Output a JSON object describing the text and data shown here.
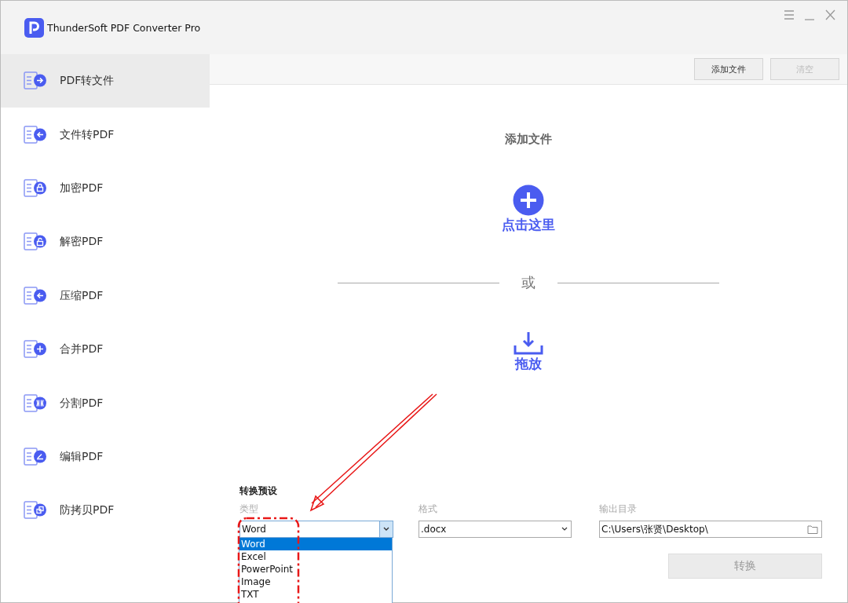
{
  "window": {
    "title": "ThunderSoft PDF Converter Pro"
  },
  "sidebar": {
    "items": [
      {
        "label": "PDF转文件",
        "kind": "export",
        "selected": true
      },
      {
        "label": "文件转PDF",
        "kind": "import",
        "selected": false
      },
      {
        "label": "加密PDF",
        "kind": "lock",
        "selected": false
      },
      {
        "label": "解密PDF",
        "kind": "unlock",
        "selected": false
      },
      {
        "label": "压缩PDF",
        "kind": "import",
        "selected": false
      },
      {
        "label": "合并PDF",
        "kind": "plus",
        "selected": false
      },
      {
        "label": "分割PDF",
        "kind": "split",
        "selected": false
      },
      {
        "label": "编辑PDF",
        "kind": "edit",
        "selected": false
      },
      {
        "label": "防拷贝PDF",
        "kind": "copy",
        "selected": false
      }
    ]
  },
  "toolbar": {
    "buttons": [
      {
        "label": "添加文件",
        "disabled": false
      },
      {
        "label": "清空",
        "disabled": true
      }
    ]
  },
  "drop_zone": {
    "title": "添加文件",
    "click_label": "点击这里",
    "separator": "或",
    "drag_label": "拖放"
  },
  "settings": {
    "title": "转换预设",
    "type": {
      "label": "类型",
      "value": "Word",
      "options": [
        {
          "label": "Word",
          "selected": true
        },
        {
          "label": "Excel",
          "selected": false
        },
        {
          "label": "PowerPoint",
          "selected": false
        },
        {
          "label": "Image",
          "selected": false
        },
        {
          "label": "TXT",
          "selected": false
        }
      ]
    },
    "format": {
      "label": "格式",
      "value": ".docx"
    },
    "output": {
      "label": "输出目录",
      "value": "C:\\Users\\张贤\\Desktop\\"
    },
    "convert_button": {
      "label": "转换",
      "disabled": true
    }
  }
}
